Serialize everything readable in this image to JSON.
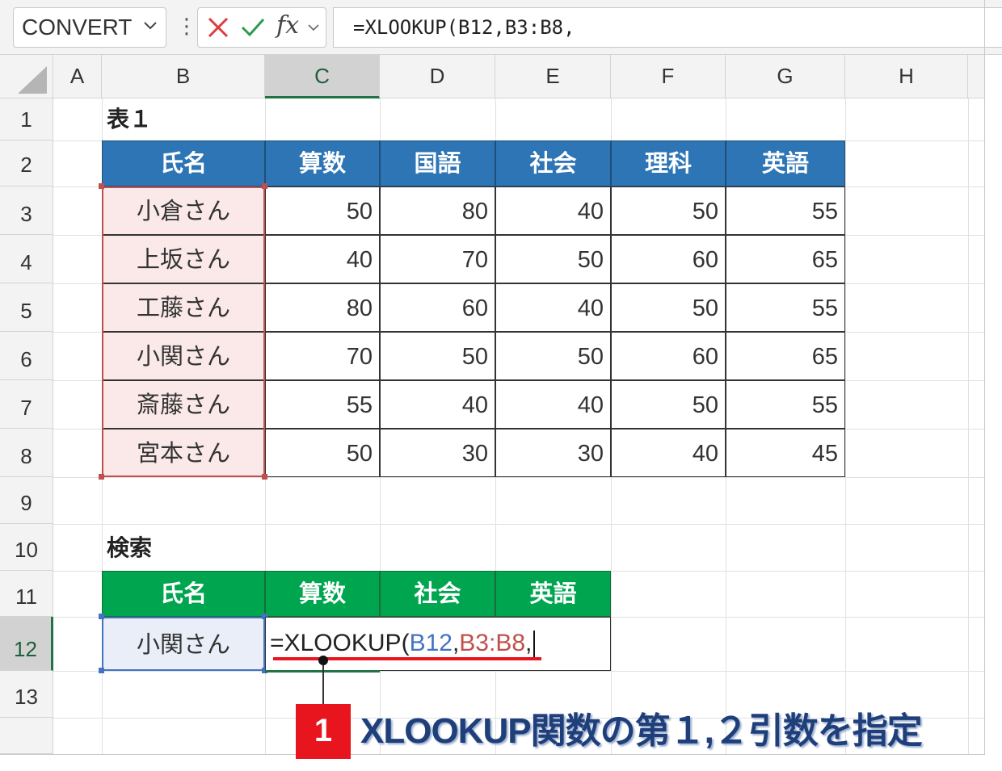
{
  "formula_bar": {
    "name_box": "CONVERT",
    "more_symbol": "⋮",
    "fx_label": "fx",
    "formula": "=XLOOKUP(B12,B3:B8,"
  },
  "columns": [
    "A",
    "B",
    "C",
    "D",
    "E",
    "F",
    "G",
    "H"
  ],
  "rows": [
    "1",
    "2",
    "3",
    "4",
    "5",
    "6",
    "7",
    "8",
    "9",
    "10",
    "11",
    "12",
    "13"
  ],
  "selected_column": "C",
  "selected_row": "12",
  "table1": {
    "title": "表１",
    "headers": [
      "氏名",
      "算数",
      "国語",
      "社会",
      "理科",
      "英語"
    ],
    "rows": [
      {
        "name": "小倉さん",
        "values": [
          "50",
          "80",
          "40",
          "50",
          "55"
        ]
      },
      {
        "name": "上坂さん",
        "values": [
          "40",
          "70",
          "50",
          "60",
          "65"
        ]
      },
      {
        "name": "工藤さん",
        "values": [
          "80",
          "60",
          "40",
          "50",
          "55"
        ]
      },
      {
        "name": "小関さん",
        "values": [
          "70",
          "50",
          "50",
          "60",
          "65"
        ]
      },
      {
        "name": "斎藤さん",
        "values": [
          "55",
          "40",
          "40",
          "50",
          "55"
        ]
      },
      {
        "name": "宮本さん",
        "values": [
          "50",
          "30",
          "30",
          "40",
          "45"
        ]
      }
    ]
  },
  "search": {
    "title": "検索",
    "headers": [
      "氏名",
      "算数",
      "社会",
      "英語"
    ],
    "name_value": "小関さん",
    "formula_parts": {
      "prefix": "=XLOOKUP(",
      "arg1": "B12",
      "sep1": ",",
      "arg2": "B3:B8",
      "sep2": ","
    }
  },
  "callout": {
    "number": "1",
    "text": "XLOOKUP関数の第１,２引数を指定"
  },
  "colors": {
    "header_blue": "#2e75b6",
    "header_green": "#00a550",
    "name_fill": "#fbe9e9",
    "ref_blue": "#4472c4",
    "ref_red": "#c0504d",
    "callout_red": "#e8141e",
    "callout_text": "#1f3f7a"
  }
}
